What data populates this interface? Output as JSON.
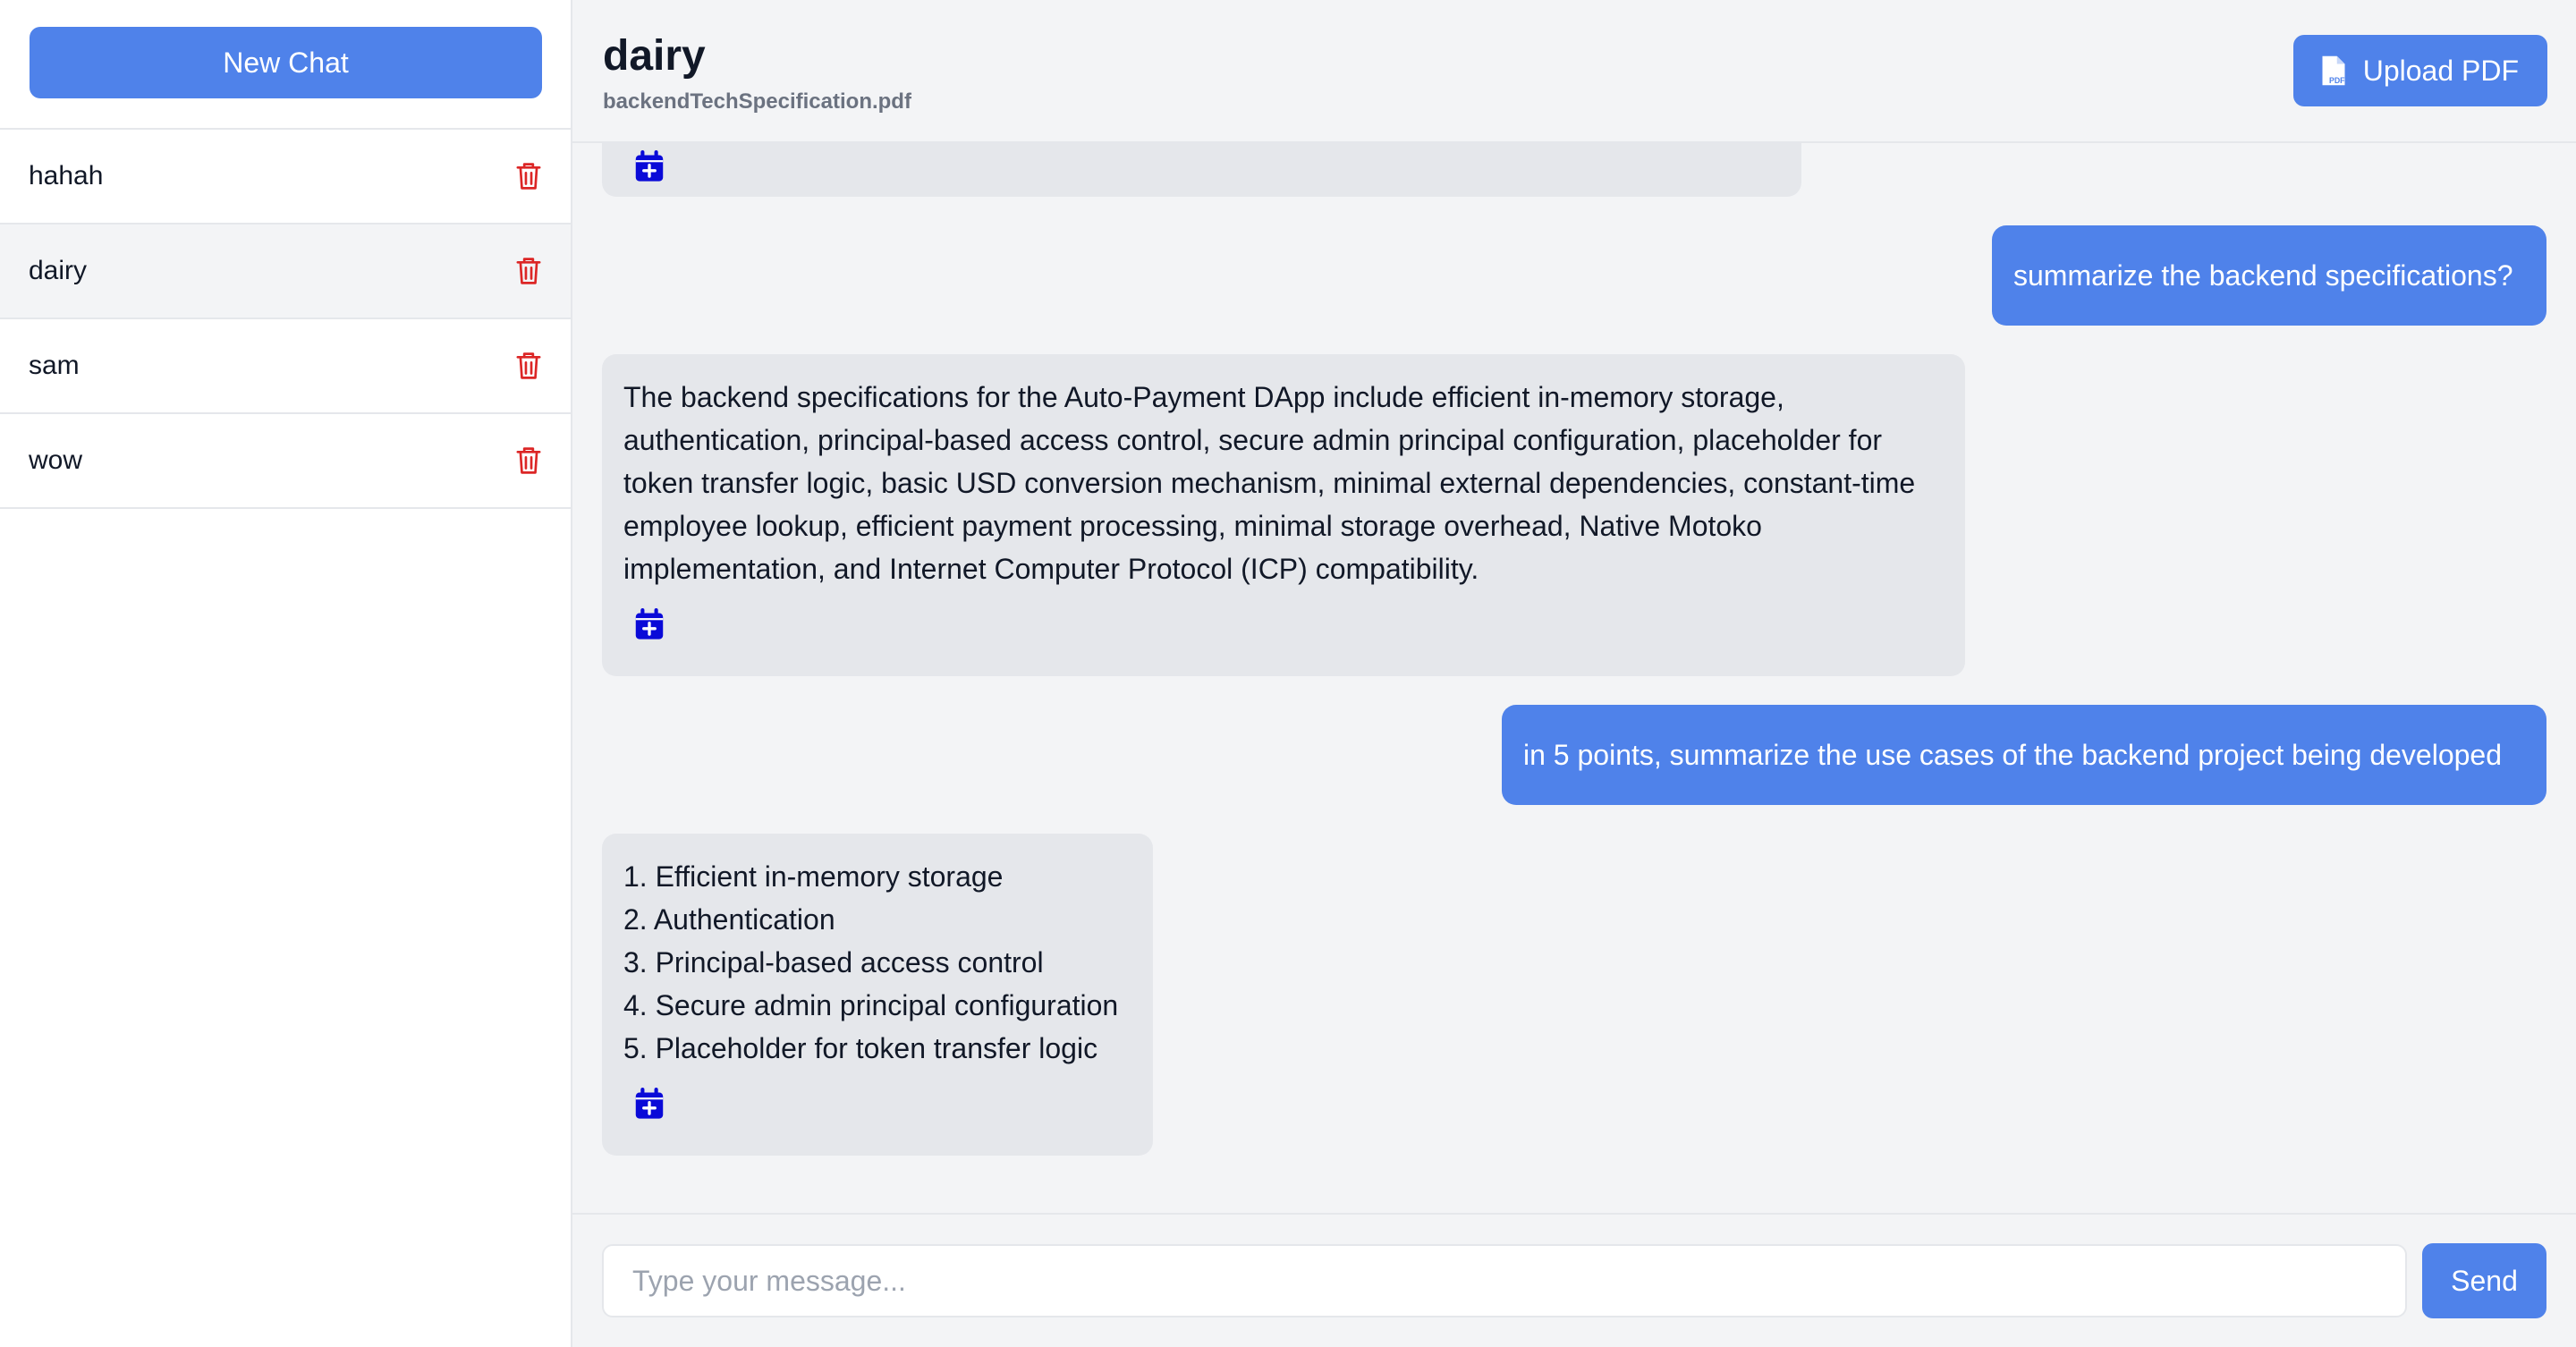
{
  "sidebar": {
    "new_chat_label": "New Chat",
    "chats": [
      {
        "label": "hahah"
      },
      {
        "label": "dairy"
      },
      {
        "label": "sam"
      },
      {
        "label": "wow"
      }
    ]
  },
  "header": {
    "title": "dairy",
    "subtitle": "backendTechSpecification.pdf",
    "upload_label": "Upload PDF"
  },
  "messages": [
    {
      "role": "user",
      "text": "summarize the backend specifications?"
    },
    {
      "role": "assistant",
      "text": "The backend specifications for the Auto-Payment DApp include efficient in-memory storage, authentication, principal-based access control, secure admin principal configuration, placeholder for token transfer logic, basic USD conversion mechanism, minimal external dependencies, constant-time employee lookup, efficient payment processing, minimal storage overhead, Native Motoko implementation, and Internet Computer Protocol (ICP) compatibility."
    },
    {
      "role": "user",
      "text": "in 5 points, summarize the use cases of the backend project being developed"
    },
    {
      "role": "assistant",
      "lines": [
        "1. Efficient in-memory storage",
        "2. Authentication",
        "3. Principal-based access control",
        "4. Secure admin principal configuration",
        "5. Placeholder for token transfer logic"
      ]
    }
  ],
  "composer": {
    "placeholder": "Type your message...",
    "send_label": "Send"
  },
  "colors": {
    "accent": "#4f82ea",
    "danger": "#dc2626",
    "calendar_icon": "#0a0ad8",
    "bot_bubble": "#e5e7eb"
  },
  "icons": {
    "chat_delete": "trash-icon",
    "message_action": "calendar-plus-icon",
    "upload": "pdf-file-icon"
  }
}
